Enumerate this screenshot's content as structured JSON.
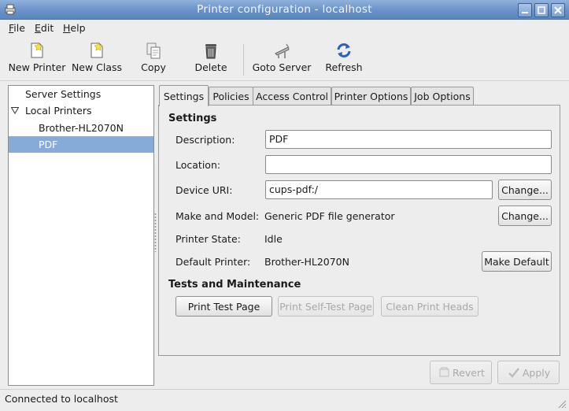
{
  "window": {
    "title": "Printer configuration - localhost",
    "title_bar_color": "#6a92c8"
  },
  "menu": [
    {
      "label": "File",
      "mnemonic": "F",
      "rest": "ile"
    },
    {
      "label": "Edit",
      "mnemonic": "E",
      "rest": "dit"
    },
    {
      "label": "Help",
      "mnemonic": "H",
      "rest": "elp"
    }
  ],
  "toolbar": {
    "new_printer": "New Printer",
    "new_class": "New Class",
    "copy": "Copy",
    "delete": "Delete",
    "goto_server": "Goto Server",
    "refresh": "Refresh"
  },
  "tree": {
    "server_settings": "Server Settings",
    "local_printers": "Local Printers",
    "printers": [
      "Brother-HL2070N",
      "PDF"
    ],
    "selected": "PDF",
    "selection_color": "#86abd9"
  },
  "tabs": [
    "Settings",
    "Policies",
    "Access Control",
    "Printer Options",
    "Job Options"
  ],
  "active_tab": "Settings",
  "settings": {
    "heading": "Settings",
    "description_label": "Description:",
    "description_value": "PDF",
    "location_label": "Location:",
    "location_value": "",
    "device_uri_label": "Device URI:",
    "device_uri_value": "cups-pdf:/",
    "change_label": "Change...",
    "make_model_label": "Make and Model:",
    "make_model_value": "Generic PDF file generator",
    "printer_state_label": "Printer State:",
    "printer_state_value": "Idle",
    "default_printer_label": "Default Printer:",
    "default_printer_value": "Brother-HL2070N",
    "make_default_label": "Make Default"
  },
  "maintenance": {
    "heading": "Tests and Maintenance",
    "print_test_page": "Print Test Page",
    "print_self_test_page": "Print Self-Test Page",
    "clean_print_heads": "Clean Print Heads"
  },
  "actions": {
    "revert": "Revert",
    "apply": "Apply"
  },
  "status": {
    "text": "Connected to localhost"
  }
}
